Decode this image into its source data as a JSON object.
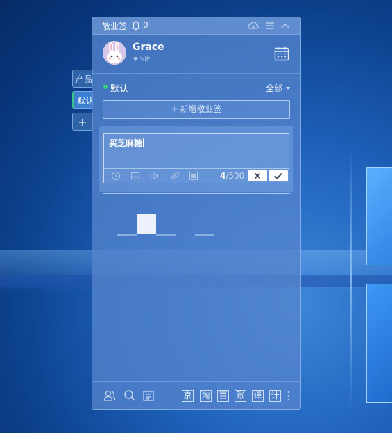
{
  "app": {
    "title": "敬业签",
    "notification_count": "0"
  },
  "user": {
    "name": "Grace",
    "badge": "VIP"
  },
  "side_tabs": [
    {
      "label": "产品",
      "active": false
    },
    {
      "label": "默认",
      "active": true
    },
    {
      "label": "+",
      "active": false
    }
  ],
  "group": {
    "name": "默认",
    "filter": "全部"
  },
  "add_button": {
    "plus": "+",
    "label": "新增敬业签"
  },
  "editor": {
    "text": "买芝麻糖",
    "count": "4",
    "limit": "/500"
  },
  "footer": {
    "quick_links": [
      "京",
      "淘",
      "百",
      "账",
      "译",
      "计"
    ]
  },
  "colors": {
    "accent_online": "#34d07e",
    "panel": "#5484cd"
  }
}
